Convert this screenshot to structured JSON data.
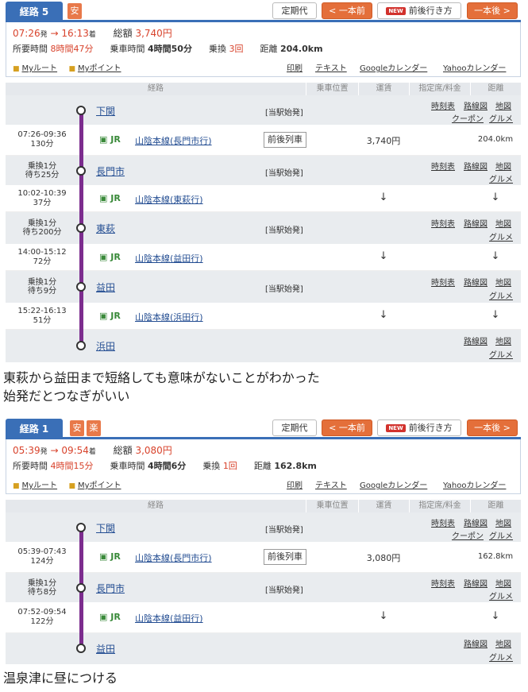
{
  "route1": {
    "tab_label": "経路 5",
    "badges": [
      "安"
    ],
    "btn_teiki": "定期代",
    "btn_prev": "< 一本前",
    "new_badge": "NEW",
    "btn_zengo": "前後行き方",
    "btn_next": "一本後 >",
    "dep_time": "07:26",
    "dep_suffix": "発",
    "arrow": "→",
    "arr_time": "16:13",
    "arr_suffix": "着",
    "fare_label": "総額",
    "fare_value": "3,740円",
    "duration_label": "所要時間",
    "duration_value": "8時間47分",
    "ride_label": "乗車時間",
    "ride_value": "4時間50分",
    "transfer_label": "乗換",
    "transfer_value": "3回",
    "distance_label": "距離",
    "distance_value": "204.0km",
    "my_route": "Myルート",
    "my_point": "Myポイント",
    "print": "印刷",
    "text": "テキスト",
    "gcal": "Googleカレンダー",
    "ycal": "Yahooカレンダー",
    "headers": [
      "経路",
      "乗車位置",
      "運賃",
      "指定席/料金",
      "距離"
    ],
    "stations": [
      {
        "name": "下関",
        "note": "[当駅始発]",
        "links": [
          "時刻表",
          "路線図",
          "地図",
          "クーポン",
          "グルメ"
        ]
      },
      {
        "name": "長門市",
        "note": "[当駅始発]",
        "wait1": "乗換1分",
        "wait2": "待ち25分",
        "links": [
          "時刻表",
          "路線図",
          "地図",
          "グルメ"
        ]
      },
      {
        "name": "東萩",
        "note": "[当駅始発]",
        "wait1": "乗換1分",
        "wait2": "待ち200分",
        "links": [
          "時刻表",
          "路線図",
          "地図",
          "グルメ"
        ]
      },
      {
        "name": "益田",
        "note": "[当駅始発]",
        "wait1": "乗換1分",
        "wait2": "待ち9分",
        "links": [
          "時刻表",
          "路線図",
          "地図",
          "グルメ"
        ]
      },
      {
        "name": "浜田",
        "links": [
          "路線図",
          "地図",
          "グルメ"
        ]
      }
    ],
    "segments": [
      {
        "time": "07:26-09:36",
        "dur": "130分",
        "jr": "JR",
        "line": "山陰本線(長門市行)",
        "pos": "前後列車",
        "fare": "3,740円",
        "dist": "204.0km"
      },
      {
        "time": "10:02-10:39",
        "dur": "37分",
        "jr": "JR",
        "line": "山陰本線(東萩行)",
        "fare": "↓",
        "dist": "↓"
      },
      {
        "time": "14:00-15:12",
        "dur": "72分",
        "jr": "JR",
        "line": "山陰本線(益田行)",
        "fare": "↓",
        "dist": "↓"
      },
      {
        "time": "15:22-16:13",
        "dur": "51分",
        "jr": "JR",
        "line": "山陰本線(浜田行)",
        "fare": "↓",
        "dist": "↓"
      }
    ]
  },
  "comment1": [
    "東萩から益田まで短絡しても意味がないことがわかった",
    "始発だとつなぎがいい"
  ],
  "route2": {
    "tab_label": "経路 1",
    "badges": [
      "安",
      "楽"
    ],
    "btn_teiki": "定期代",
    "btn_prev": "< 一本前",
    "new_badge": "NEW",
    "btn_zengo": "前後行き方",
    "btn_next": "一本後 >",
    "dep_time": "05:39",
    "dep_suffix": "発",
    "arrow": "→",
    "arr_time": "09:54",
    "arr_suffix": "着",
    "fare_label": "総額",
    "fare_value": "3,080円",
    "duration_label": "所要時間",
    "duration_value": "4時間15分",
    "ride_label": "乗車時間",
    "ride_value": "4時間6分",
    "transfer_label": "乗換",
    "transfer_value": "1回",
    "distance_label": "距離",
    "distance_value": "162.8km",
    "my_route": "Myルート",
    "my_point": "Myポイント",
    "print": "印刷",
    "text": "テキスト",
    "gcal": "Googleカレンダー",
    "ycal": "Yahooカレンダー",
    "headers": [
      "経路",
      "乗車位置",
      "運賃",
      "指定席/料金",
      "距離"
    ],
    "stations": [
      {
        "name": "下関",
        "note": "[当駅始発]",
        "links": [
          "時刻表",
          "路線図",
          "地図",
          "クーポン",
          "グルメ"
        ]
      },
      {
        "name": "長門市",
        "note": "[当駅始発]",
        "wait1": "乗換1分",
        "wait2": "待ち8分",
        "links": [
          "時刻表",
          "路線図",
          "地図",
          "グルメ"
        ]
      },
      {
        "name": "益田",
        "links": [
          "路線図",
          "地図",
          "グルメ"
        ]
      }
    ],
    "segments": [
      {
        "time": "05:39-07:43",
        "dur": "124分",
        "jr": "JR",
        "line": "山陰本線(長門市行)",
        "pos": "前後列車",
        "fare": "3,080円",
        "dist": "162.8km"
      },
      {
        "time": "07:52-09:54",
        "dur": "122分",
        "jr": "JR",
        "line": "山陰本線(益田行)",
        "fare": "↓",
        "dist": "↓"
      }
    ]
  },
  "comment2": "温泉津に昼につける"
}
